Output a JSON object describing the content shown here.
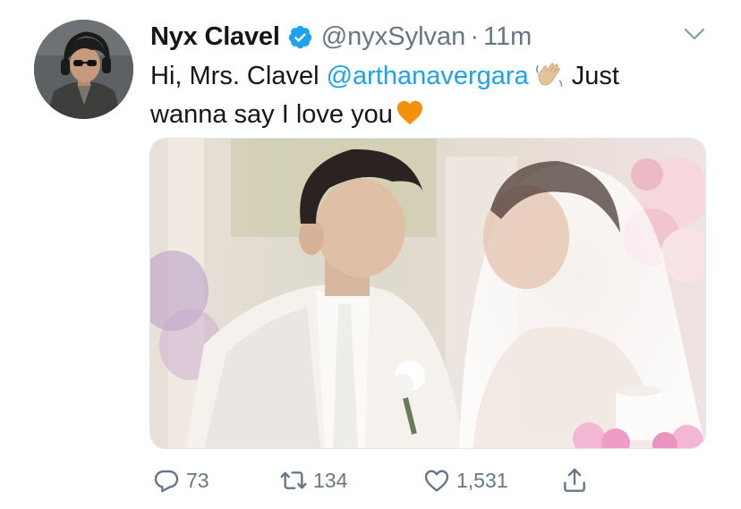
{
  "tweet": {
    "display_name": "Nyx Clavel",
    "handle": "@nyxSylvan",
    "separator": "·",
    "timestamp": "11m",
    "text": {
      "part1": "Hi, Mrs. Clavel",
      "mention": "@arthanavergara",
      "part2": "Just",
      "line2": "wanna say I love you"
    },
    "emojis": [
      "waving-hand",
      "orange-heart"
    ],
    "stats": {
      "replies": "73",
      "retweets": "134",
      "likes": "1,531"
    }
  },
  "colors": {
    "accent": "#1da1f2",
    "muted": "#657786",
    "text": "#14171a",
    "heart_emoji": "#f4900c"
  },
  "icons": {
    "verified": "verified-badge-icon",
    "menu": "chevron-down-icon",
    "reply": "reply-icon",
    "retweet": "retweet-icon",
    "like": "heart-icon",
    "share": "share-icon"
  }
}
